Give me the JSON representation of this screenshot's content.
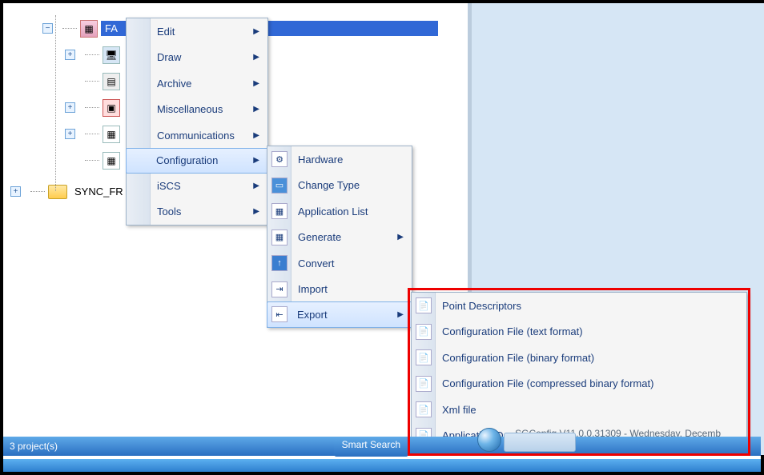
{
  "tree": {
    "selected_label": "FA",
    "folder_label": "SYNC_FR"
  },
  "menu1": {
    "items": [
      {
        "label": "Edit",
        "arrow": true
      },
      {
        "label": "Draw",
        "arrow": true
      },
      {
        "label": "Archive",
        "arrow": true
      },
      {
        "label": "Miscellaneous",
        "arrow": true
      },
      {
        "label": "Communications",
        "arrow": true
      },
      {
        "label": "Configuration",
        "arrow": true,
        "hover": true
      },
      {
        "label": "iSCS",
        "arrow": true
      },
      {
        "label": "Tools",
        "arrow": true
      }
    ]
  },
  "menu2": {
    "items": [
      {
        "label": "Hardware",
        "icon": "hw"
      },
      {
        "label": "Change Type",
        "icon": "ct"
      },
      {
        "label": "Application List",
        "icon": "al"
      },
      {
        "label": "Generate",
        "icon": "gn",
        "arrow": true
      },
      {
        "label": "Convert",
        "icon": "cv"
      },
      {
        "label": "Import",
        "icon": "im"
      },
      {
        "label": "Export",
        "icon": "ex",
        "arrow": true,
        "hover": true
      }
    ]
  },
  "menu3": {
    "items": [
      {
        "label": "Point Descriptors",
        "icon": "pd"
      },
      {
        "label": "Configuration File (text format)",
        "icon": "cf"
      },
      {
        "label": "Configuration File (binary format)",
        "icon": "cf"
      },
      {
        "label": "Configuration File (compressed binary format)",
        "icon": "cf"
      },
      {
        "label": "Xml file",
        "icon": "xm"
      },
      {
        "label": "Application Documentation",
        "icon": "ad"
      }
    ]
  },
  "status": {
    "projects": "3 project(s)",
    "smart_search": "Smart Search"
  },
  "task": {
    "text": "- SGConfig    V11.0.0.31309 - Wednesday, Decemb"
  }
}
